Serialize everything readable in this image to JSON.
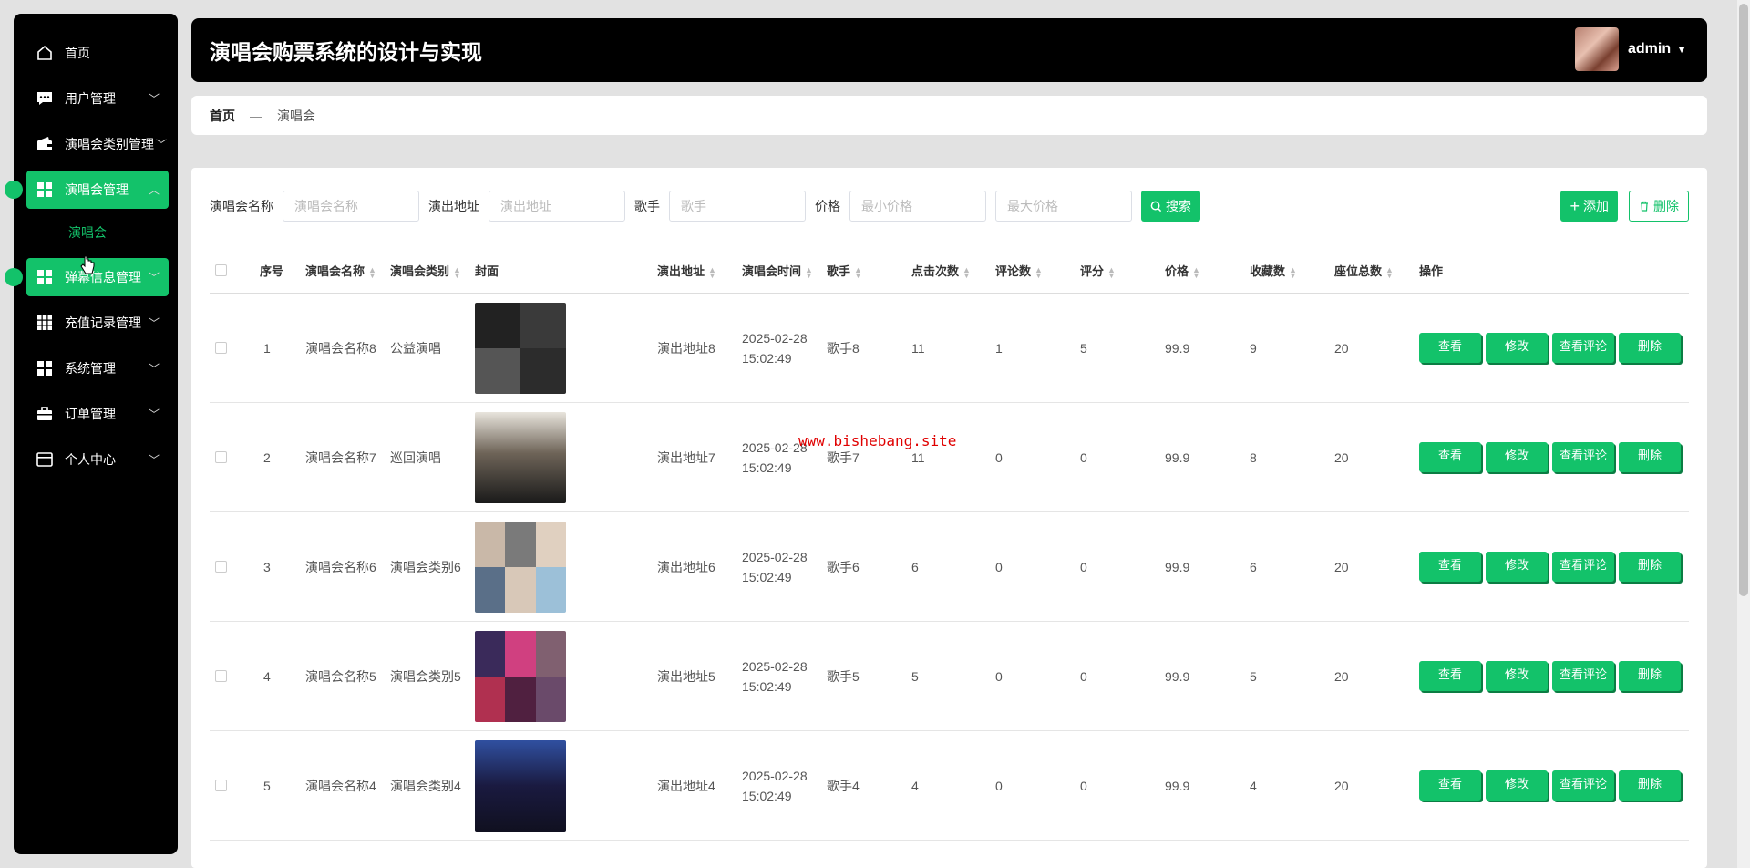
{
  "app": {
    "title": "演唱会购票系统的设计与实现"
  },
  "user": {
    "name": "admin"
  },
  "sidebar": {
    "items": [
      {
        "label": "首页",
        "icon": "home-icon",
        "chevron": false,
        "active": false
      },
      {
        "label": "用户管理",
        "icon": "chat-icon",
        "chevron": true,
        "active": false
      },
      {
        "label": "演唱会类别管理",
        "icon": "wallet-icon",
        "chevron": true,
        "active": false
      },
      {
        "label": "演唱会管理",
        "icon": "grid-icon",
        "chevron": true,
        "active": true,
        "expanded": true
      },
      {
        "label": "弹幕信息管理",
        "icon": "grid-icon",
        "chevron": true,
        "active": true
      },
      {
        "label": "充值记录管理",
        "icon": "grid9-icon",
        "chevron": true,
        "active": false
      },
      {
        "label": "系统管理",
        "icon": "grid-icon",
        "chevron": true,
        "active": false
      },
      {
        "label": "订单管理",
        "icon": "briefcase-icon",
        "chevron": true,
        "active": false
      },
      {
        "label": "个人中心",
        "icon": "card-icon",
        "chevron": true,
        "active": false
      }
    ],
    "submenu": {
      "label": "演唱会"
    }
  },
  "breadcrumb": {
    "home": "首页",
    "separator": "—",
    "current": "演唱会"
  },
  "search": {
    "name_label": "演唱会名称",
    "name_placeholder": "演唱会名称",
    "address_label": "演出地址",
    "address_placeholder": "演出地址",
    "singer_label": "歌手",
    "singer_placeholder": "歌手",
    "price_label": "价格",
    "min_price_placeholder": "最小价格",
    "max_price_placeholder": "最大价格",
    "search_button": "搜索",
    "add_button": "添加",
    "delete_button": "删除"
  },
  "table": {
    "columns": [
      "序号",
      "演唱会名称",
      "演唱会类别",
      "封面",
      "演出地址",
      "演唱会时间",
      "歌手",
      "点击次数",
      "评论数",
      "评分",
      "价格",
      "收藏数",
      "座位总数",
      "操作"
    ],
    "ops": {
      "view": "查看",
      "edit": "修改",
      "comments": "查看评论",
      "delete": "删除"
    },
    "rows": [
      {
        "index": "1",
        "name": "演唱会名称8",
        "category": "公益演唱",
        "address": "演出地址8",
        "date": "2025-02-28",
        "time": "15:02:49",
        "singer": "歌手8",
        "clicks": "11",
        "comments": "1",
        "rating": "5",
        "price": "99.9",
        "favorites": "9",
        "seats": "20"
      },
      {
        "index": "2",
        "name": "演唱会名称7",
        "category": "巡回演唱",
        "address": "演出地址7",
        "date": "2025-02-28",
        "time": "15:02:49",
        "singer": "歌手7",
        "clicks": "11",
        "comments": "0",
        "rating": "0",
        "price": "99.9",
        "favorites": "8",
        "seats": "20"
      },
      {
        "index": "3",
        "name": "演唱会名称6",
        "category": "演唱会类别6",
        "address": "演出地址6",
        "date": "2025-02-28",
        "time": "15:02:49",
        "singer": "歌手6",
        "clicks": "6",
        "comments": "0",
        "rating": "0",
        "price": "99.9",
        "favorites": "6",
        "seats": "20"
      },
      {
        "index": "4",
        "name": "演唱会名称5",
        "category": "演唱会类别5",
        "address": "演出地址5",
        "date": "2025-02-28",
        "time": "15:02:49",
        "singer": "歌手5",
        "clicks": "5",
        "comments": "0",
        "rating": "0",
        "price": "99.9",
        "favorites": "5",
        "seats": "20"
      },
      {
        "index": "5",
        "name": "演唱会名称4",
        "category": "演唱会类别4",
        "address": "演出地址4",
        "date": "2025-02-28",
        "time": "15:02:49",
        "singer": "歌手4",
        "clicks": "4",
        "comments": "0",
        "rating": "0",
        "price": "99.9",
        "favorites": "4",
        "seats": "20"
      }
    ]
  },
  "watermark": "www.bishebang.site",
  "colors": {
    "accent": "#13c26a",
    "sidebar_bg": "#000000",
    "header_bg": "#000000",
    "page_bg": "#e2e2e2",
    "watermark": "#e00000"
  }
}
